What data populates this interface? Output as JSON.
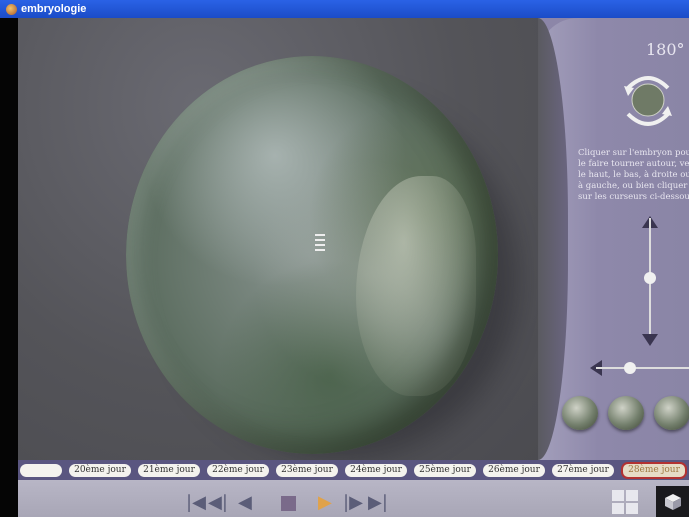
{
  "window": {
    "title": "embryologie"
  },
  "view": {
    "rotation_label": "180°"
  },
  "panel": {
    "instructions": "Cliquer sur l'embryon pour le faire tourner autour, vers le haut, le bas, à droite ou à gauche, ou bien cliquer sur les curseurs ci-dessous."
  },
  "timeline": {
    "days": [
      "",
      "20ème jour",
      "21ème jour",
      "22ème jour",
      "23ème jour",
      "24ème jour",
      "25ème jour",
      "26ème jour",
      "27ème jour",
      "28ème jour"
    ],
    "active_index": 9
  },
  "controls": {
    "first_icon": "skip-to-start-icon",
    "prev_icon": "step-back-icon",
    "back_icon": "play-backward-icon",
    "stop_icon": "stop-icon",
    "play_icon": "play-forward-icon",
    "next_icon": "step-forward-icon",
    "last_icon": "skip-to-end-icon"
  },
  "colors": {
    "accent": "#e0a24a",
    "panel": "#8c86a8",
    "timeline": "#5a5680",
    "active_border": "#b23232"
  }
}
